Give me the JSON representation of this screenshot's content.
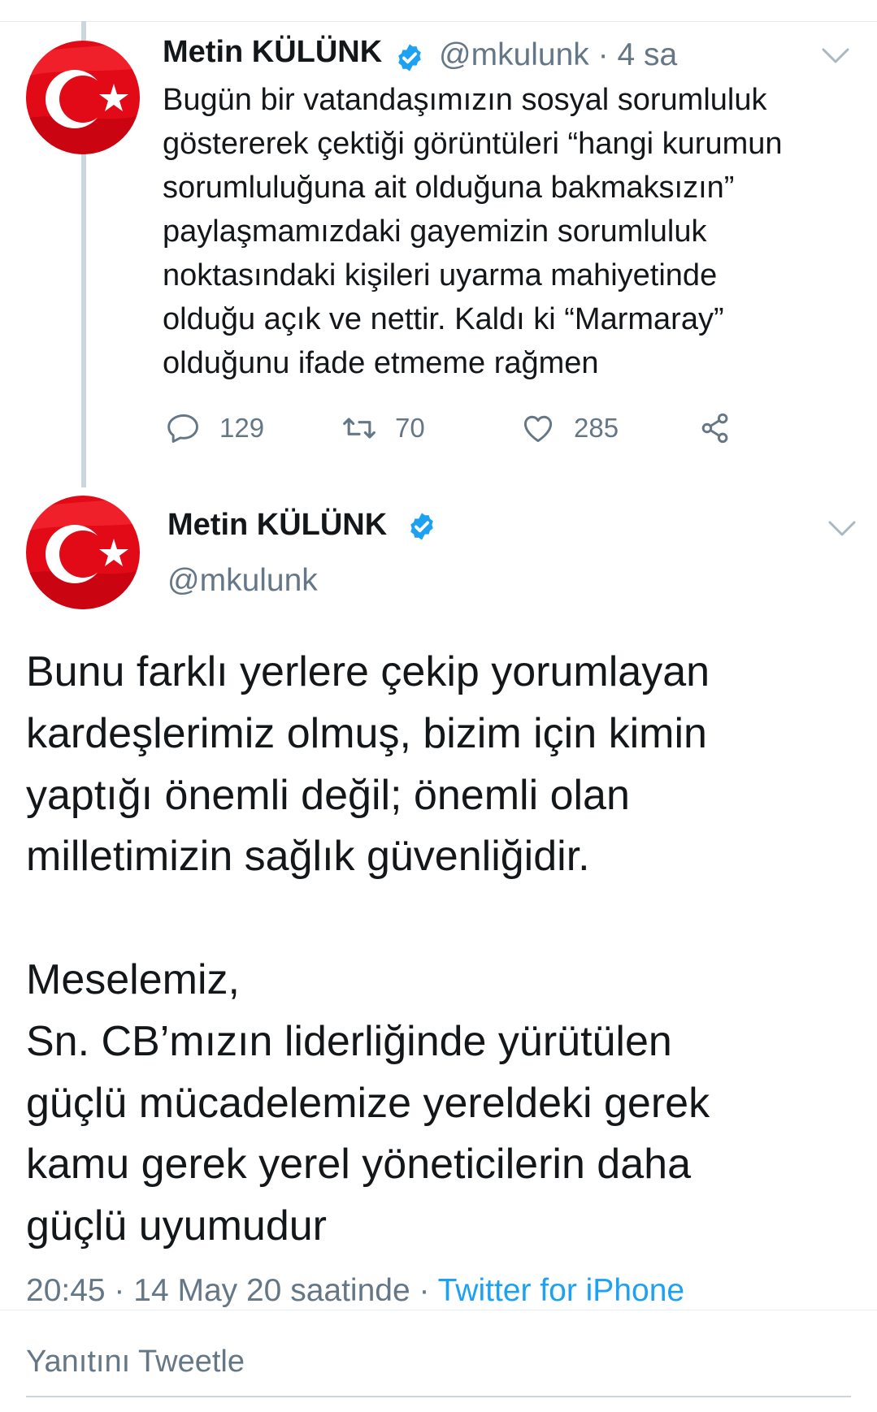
{
  "tweet1": {
    "author_name": "Metin KÜLÜNK",
    "handle_time": "@mkulunk · 4 sa",
    "text_lines": [
      "Bugün bir vatandaşımızın sosyal sorumluluk",
      "göstererek çektiği görüntüleri “hangi kurumun",
      "sorumluluğuna ait olduğuna bakmaksızın”",
      "paylaşmamızdaki gayemizin sorumluluk",
      "noktasındaki kişileri uyarma mahiyetinde",
      "olduğu açık ve nettir. Kaldı ki “Marmaray”",
      "olduğunu ifade etmeme rağmen"
    ],
    "replies": "129",
    "retweets": "70",
    "likes": "285"
  },
  "tweet2": {
    "author_name": "Metin KÜLÜNK",
    "handle": "@mkulunk",
    "text_lines": [
      "Bunu farklı yerlere çekip yorumlayan",
      "kardeşlerimiz olmuş, bizim için kimin",
      "yaptığı önemli değil; önemli olan",
      "milletimizin sağlık güvenliğidir.",
      "",
      "Meselemiz,",
      "Sn. CB’mızın liderliğinde yürütülen",
      "güçlü mücadelemize yereldeki gerek",
      "kamu gerek yerel yöneticilerin daha",
      "güçlü uyumudur"
    ],
    "timestamp": "20:45 · 14 May 20 saatinde · ",
    "source": "Twitter for iPhone"
  },
  "reply_placeholder": "Yanıtını Tweetle",
  "colors": {
    "accent": "#1da1f2",
    "secondary_text": "#657786",
    "avatar_red": "#e30a17"
  },
  "icons": [
    "verified-icon",
    "chevron-down-icon",
    "reply-icon",
    "retweet-icon",
    "like-icon",
    "share-icon"
  ]
}
